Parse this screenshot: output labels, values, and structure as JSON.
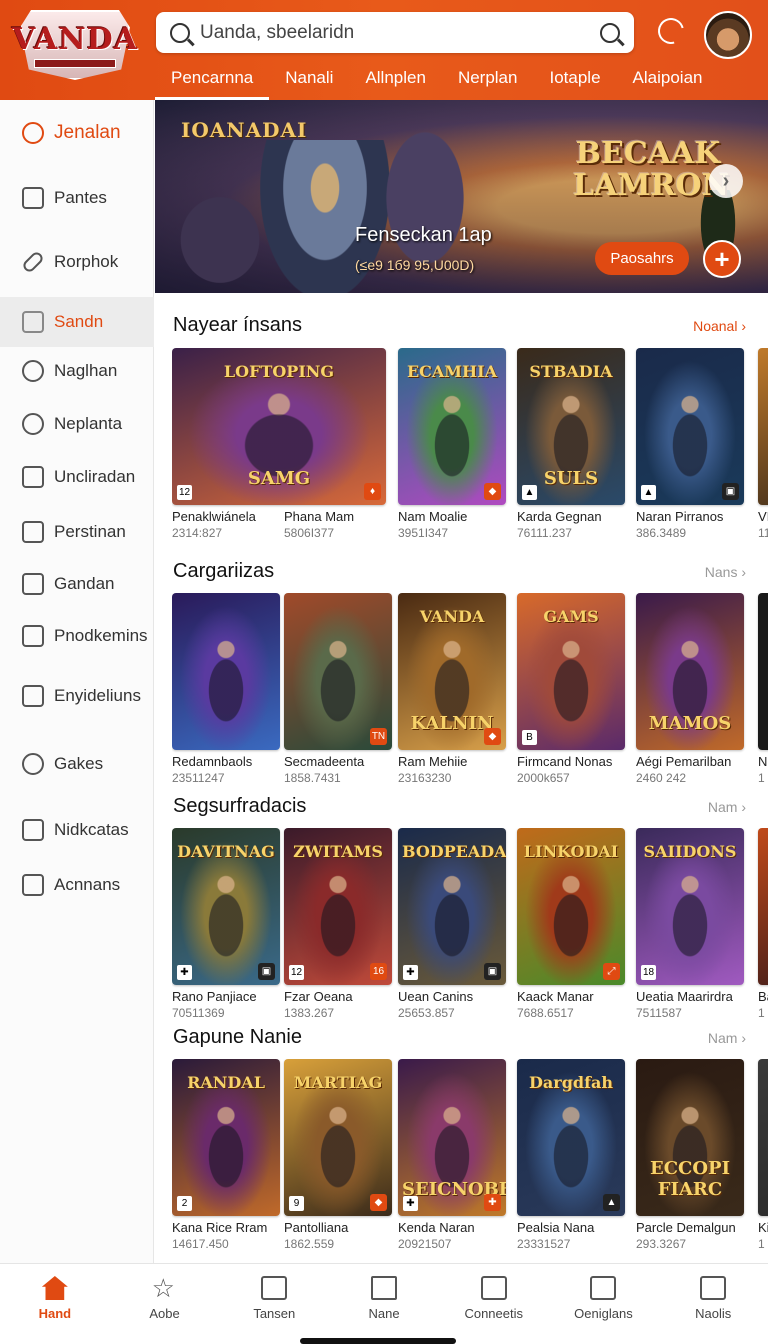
{
  "header": {
    "logo_text": "VANDA",
    "search_placeholder": "Uanda, sbeelaridn",
    "tabs": [
      {
        "label": "Pencarnna",
        "active": true
      },
      {
        "label": "Nanali"
      },
      {
        "label": "Allnplen"
      },
      {
        "label": "Nerplan"
      },
      {
        "label": "Iotaple"
      },
      {
        "label": "Alaipoian"
      }
    ]
  },
  "sidebar": {
    "items": [
      {
        "label": "Jenalan",
        "icon": "search-icon"
      },
      {
        "label": "Pantes",
        "icon": "list-icon"
      },
      {
        "label": "Rorphok",
        "icon": "pill-icon"
      },
      {
        "label": "Sandn",
        "icon": "bookmark-icon",
        "active": true
      },
      {
        "label": "Naglhan",
        "icon": "search-icon"
      },
      {
        "label": "Neplanta",
        "icon": "circle-icon"
      },
      {
        "label": "Uncliradan",
        "icon": "calendar-icon"
      },
      {
        "label": "Perstinan",
        "icon": "flag-icon"
      },
      {
        "label": "Gandan",
        "icon": "check-box-icon"
      },
      {
        "label": "Pnodkemins",
        "icon": "location-icon"
      },
      {
        "label": "Enyideliuns",
        "icon": "layers-icon"
      },
      {
        "label": "Gakes",
        "icon": "chat-icon"
      },
      {
        "label": "Nidkcatas",
        "icon": "tag-icon"
      },
      {
        "label": "Acnnans",
        "icon": "box-icon"
      }
    ]
  },
  "banner": {
    "left_logo": "IOANADAI",
    "right_title": "BECAAK LAMRON",
    "caption": "Fenseckan 1ap",
    "sub": "(≤e9 1б9 95,U00D)",
    "button_label": "Paosahrs",
    "plus": "+",
    "next": "›"
  },
  "sections": [
    {
      "title": "Nayear ínsans",
      "more": "Noanal ›",
      "cards": [
        {
          "title_art": "LOFTOPING",
          "bottom_art": "SAMG",
          "name": "Penaklwiánela",
          "meta": "2314:827",
          "badge_l": "12",
          "badge_r": "♦",
          "colors": [
            "#3a2048",
            "#7a3a8a",
            "#d86a3a"
          ]
        },
        {
          "name": "Phana Mam",
          "meta": "5806І377"
        },
        {
          "title_art": "ECAMHIA",
          "name": "Nam Moalie",
          "meta": "3951І347",
          "badge_r": "◆",
          "colors": [
            "#2a6a8a",
            "#4a8a4a",
            "#b04ac0"
          ]
        },
        {
          "title_art": "STBADIA",
          "bottom_art": "SULS",
          "name": "Karda Gegnan",
          "meta": "76111.237",
          "badge_l": "▲",
          "colors": [
            "#3a2a1a",
            "#7a5a3a",
            "#2a4a6a"
          ]
        },
        {
          "name": "Naran Pirranos",
          "meta": "386.3489",
          "badge_l": "▲",
          "badge_r_dark": "▣",
          "colors": [
            "#1a2a4a",
            "#3a5a8a",
            "#1a3a5a"
          ]
        },
        {
          "name": "VI",
          "meta": "11",
          "colors": [
            "#c07a2a",
            "#8a4a1a",
            "#3a2a1a"
          ]
        }
      ]
    },
    {
      "title": "Cargariizas",
      "more": "Nans ›",
      "cards": [
        {
          "name": "Redamnbaols",
          "meta": "23511247",
          "colors": [
            "#2a1a5a",
            "#5a3aa0",
            "#3a6ac0"
          ]
        },
        {
          "name": "Secmadeenta",
          "meta": "1858.7431",
          "badge_r": "TN",
          "colors": [
            "#a04a2a",
            "#5a6a4a",
            "#2a4a3a"
          ]
        },
        {
          "title_art": "VANDA",
          "bottom_art": "KALNIN",
          "name": "Ram Mehiie",
          "meta": "23163230",
          "badge_r": "◆",
          "colors": [
            "#4a2a12",
            "#a06a2a",
            "#d8a04a"
          ]
        },
        {
          "title_art": "GAMS",
          "name": "Firmcand Nonas",
          "meta": "2000k657",
          "badge_l": "B",
          "colors": [
            "#d86a2a",
            "#a04a3a",
            "#5a2a6a"
          ]
        },
        {
          "bottom_art": "MAMOS",
          "name": "Aégi Pemarilban",
          "meta": "2460 242",
          "colors": [
            "#3a1a4a",
            "#7a3a8a",
            "#c06a2a"
          ]
        },
        {
          "name": "N",
          "meta": "1",
          "colors": [
            "#1a1a1a",
            "#3a3a3a",
            "#1a1a1a"
          ]
        }
      ]
    },
    {
      "title": "Segsurfradacis",
      "more": "Nam ›",
      "cards": [
        {
          "title_art": "DAVITNAG",
          "name": "Rano Panjiace",
          "meta": "70511369",
          "badge_l": "✚",
          "badge_r_dark": "▣",
          "colors": [
            "#2a3a2a",
            "#8a7a3a",
            "#3a6a8a"
          ]
        },
        {
          "title_art": "ZWITAMS",
          "name": "Fzar Oeana",
          "meta": "1383.267",
          "badge_l": "12",
          "badge_r": "16",
          "colors": [
            "#3a1a2a",
            "#8a2a2a",
            "#c04a3a"
          ]
        },
        {
          "title_art": "BODPEADAI",
          "name": "Uean Canins",
          "meta": "25653.857",
          "badge_l": "✚",
          "badge_r_dark": "▣",
          "colors": [
            "#1a2a4a",
            "#3a4a7a",
            "#6a5a3a"
          ]
        },
        {
          "title_art": "LINKODAI",
          "name": "Kaack Manar",
          "meta": "7688.6517",
          "badge_r": "⤢",
          "colors": [
            "#c06a1a",
            "#a03a1a",
            "#4a8a2a"
          ]
        },
        {
          "title_art": "SAIIDONS",
          "name": "Ueatia Maarirdra",
          "meta": "7511587",
          "badge_l": "18",
          "colors": [
            "#3a2a5a",
            "#7a4aa0",
            "#a05ac0"
          ]
        },
        {
          "name": "Ba",
          "meta": "1",
          "colors": [
            "#c04a1a",
            "#8a2a1a",
            "#3a1a1a"
          ]
        }
      ]
    },
    {
      "title": "Gapune Nanie",
      "more": "Nam ›",
      "cards": [
        {
          "title_art": "RANDAL",
          "name": "Kana Rice Rram",
          "meta": "14617.450",
          "badge_l": "2",
          "colors": [
            "#2a1a3a",
            "#6a2a6a",
            "#c06a2a"
          ]
        },
        {
          "title_art": "MARTIAG",
          "name": "Pantolliana",
          "meta": "1862.559",
          "badge_l": "9",
          "badge_r": "◆",
          "colors": [
            "#d8a03a",
            "#8a5a2a",
            "#3a2a1a"
          ]
        },
        {
          "bottom_art": "SEICNOBE",
          "name": "Kenda Naran",
          "meta": "20921507",
          "badge_l": "✚",
          "badge_r": "✚",
          "colors": [
            "#3a1a4a",
            "#8a3a6a",
            "#c07a2a"
          ]
        },
        {
          "title_art": "Dargdfah",
          "name": "Pealsia Nana",
          "meta": "23331527",
          "badge_r_dark": "▲",
          "colors": [
            "#1a2a4a",
            "#3a5a8a",
            "#2a3a5a"
          ]
        },
        {
          "bottom_art": "ECCOPI FIARC",
          "name": "Parcle Demalgun",
          "meta": "293.3267",
          "colors": [
            "#2a1a12",
            "#6a4a2a",
            "#3a2a1a"
          ]
        },
        {
          "name": "Ki",
          "meta": "1",
          "colors": [
            "#3a3a3a",
            "#6a6a6a",
            "#2a2a2a"
          ]
        }
      ]
    }
  ],
  "bottom_nav": [
    {
      "label": "Hand",
      "icon": "home-icon",
      "active": true
    },
    {
      "label": "Aobe",
      "icon": "star-icon"
    },
    {
      "label": "Tansen",
      "icon": "list-icon"
    },
    {
      "label": "Nane",
      "icon": "house-icon"
    },
    {
      "label": "Conneetis",
      "icon": "eraser-icon"
    },
    {
      "label": "Oeniglans",
      "icon": "document-icon"
    },
    {
      "label": "Naolis",
      "icon": "puzzle-icon"
    }
  ],
  "colors": {
    "accent": "#e04a12"
  }
}
